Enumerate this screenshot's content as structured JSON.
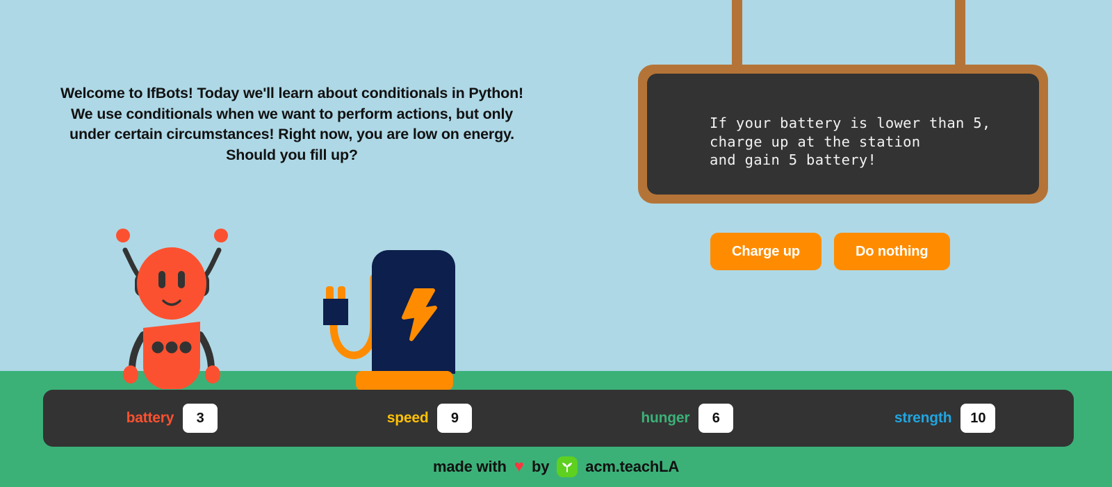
{
  "app": {
    "title": "IfBots",
    "sky_color": "#aed8e6",
    "ground_color": "#3bb178"
  },
  "intro": {
    "text": "Welcome to IfBots! Today we'll learn about conditionals in Python! We use conditionals when we want to perform actions, but only under certain circumstances! Right now, you are low on energy. Should you fill up?"
  },
  "sign": {
    "code": "If your battery is lower than 5,\ncharge up at the station\nand gain 5 battery!",
    "frame_color": "#b57437",
    "board_color": "#333333",
    "text_color": "#f2f2f2"
  },
  "choices": {
    "accent_color": "#ff8c00",
    "buttons": [
      {
        "label": "Charge up",
        "name": "charge-up-button"
      },
      {
        "label": "Do nothing",
        "name": "do-nothing-button"
      }
    ]
  },
  "scene": {
    "robot": {
      "name": "robot-character",
      "body_color": "#fc5130",
      "detail_color": "#333333"
    },
    "station": {
      "name": "charging-station",
      "body_color": "#0d1f4c",
      "bolt_color": "#ff8c00",
      "cable_color": "#ff8c00",
      "base_color": "#ff8c00"
    }
  },
  "stats": {
    "bar_color": "#333333",
    "items": [
      {
        "label": "battery",
        "value": "3",
        "color": "#fc5130",
        "name": "stat-battery"
      },
      {
        "label": "speed",
        "value": "9",
        "color": "#ffc107",
        "name": "stat-speed"
      },
      {
        "label": "hunger",
        "value": "6",
        "color": "#3bb178",
        "name": "stat-hunger"
      },
      {
        "label": "strength",
        "value": "10",
        "color": "#21a5e0",
        "name": "stat-strength"
      }
    ]
  },
  "footer": {
    "made_with": "made with",
    "heart": "♥",
    "by": "by",
    "brand": "acm.teachLA",
    "logo_color": "#5ed020",
    "heart_color": "#fb3640"
  }
}
